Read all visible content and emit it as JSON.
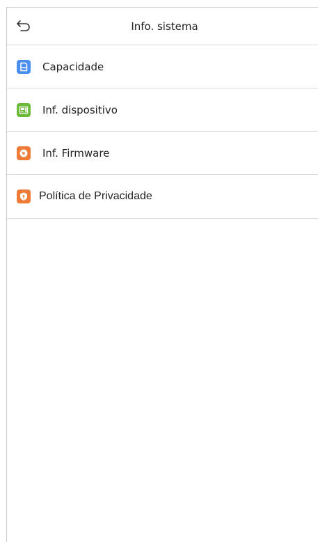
{
  "header": {
    "title": "Info. sistema",
    "back_icon": "back-arrow-icon"
  },
  "menu": {
    "items": [
      {
        "label": "Capacidade",
        "icon": "sd-card-icon",
        "color": "#4a8ff0"
      },
      {
        "label": "Inf. dispositivo",
        "icon": "device-icon",
        "color": "#6cba3a"
      },
      {
        "label": "Inf. Firmware",
        "icon": "firmware-disc-icon",
        "color": "#f07a37"
      },
      {
        "label": "Política de Privacidade",
        "icon": "privacy-shield-icon",
        "color": "#f07a37"
      }
    ]
  }
}
